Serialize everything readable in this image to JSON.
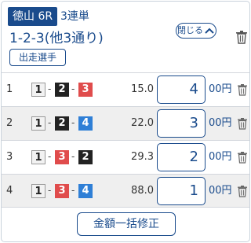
{
  "header": {
    "venue_race": "徳山 6R",
    "bet_type": "3連単",
    "combination_summary": "1-2-3(他3通り)",
    "close_label": "閉じる",
    "entrants_label": "出走選手"
  },
  "rows": [
    {
      "index": "1",
      "boats": [
        "1",
        "2",
        "3"
      ],
      "odds": "15.0",
      "amount": "4",
      "unit": "00円"
    },
    {
      "index": "2",
      "boats": [
        "1",
        "2",
        "4"
      ],
      "odds": "22.0",
      "amount": "3",
      "unit": "00円"
    },
    {
      "index": "3",
      "boats": [
        "1",
        "3",
        "2"
      ],
      "odds": "29.3",
      "amount": "2",
      "unit": "00円"
    },
    {
      "index": "4",
      "boats": [
        "1",
        "3",
        "4"
      ],
      "odds": "88.0",
      "amount": "1",
      "unit": "00円"
    }
  ],
  "separator": "-",
  "bulk_edit_label": "金額一括修正",
  "colors": {
    "accent": "#1a4b8c",
    "boat_1": "#f2f2f2",
    "boat_2": "#222222",
    "boat_3": "#e04c4c",
    "boat_4": "#2f7fd6",
    "alt_row": "#efefef"
  },
  "icons": {
    "close_chevron": "chevron-up-icon",
    "delete": "trash-icon"
  }
}
